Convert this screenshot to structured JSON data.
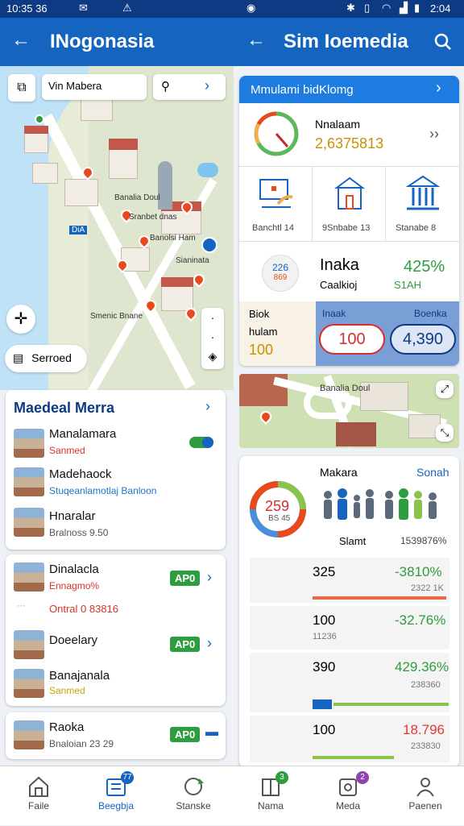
{
  "status": {
    "time_left": "10:35 36",
    "time_right": "2:04"
  },
  "left_header": {
    "title": "INogonasia"
  },
  "right_header": {
    "title": "Sim Ioemedia"
  },
  "map": {
    "search_text": "Vin Mabera",
    "labels": [
      "Banalia Doul",
      "Sranbet dnas",
      "Banolsi Ham",
      "Sianinata",
      "Smenic Bnane",
      "DiA"
    ],
    "saved_label": "Serroed"
  },
  "list_card1": {
    "title": "Maedeal Merra",
    "items": [
      {
        "title": "Manalamara",
        "sub": "Sanmed",
        "sub_color": "#d6342a"
      },
      {
        "title": "Madehaock",
        "sub": "Stuqeanlamotlaj Banloon",
        "sub_color": "#1976d2"
      },
      {
        "title": "Hnaralar",
        "sub": "Bralnoss 9.50",
        "sub_color": "#555555"
      }
    ]
  },
  "list_card2": {
    "items": [
      {
        "title": "Dinalacla",
        "sub": "Ennagmo%",
        "pill": "AP0"
      },
      {
        "title": "Ontral 0 83816",
        "sub": ""
      },
      {
        "title": "Doeelary",
        "sub": "",
        "pill": "AP0"
      },
      {
        "title": "Banajanala",
        "sub": "Sanmed"
      }
    ]
  },
  "list_card3": {
    "title": "Raoka",
    "sub": "Bnaloian 23 29",
    "pill": "AP0"
  },
  "info_card": {
    "header": "Mmulami bidKlomg",
    "gauge_label": "Nnalaam",
    "gauge_value": "2,6375813",
    "icons": [
      {
        "label": "Banchtl 14"
      },
      {
        "label": "9Snbabe 13"
      },
      {
        "label": "Stanabe 8"
      }
    ],
    "stat_badge_top": "226",
    "stat_badge_bottom": "869",
    "stat_label": "Inaka",
    "stat_sub": "Caalkioj",
    "stat_pct": "425%",
    "stat_pct_sub": "S1AH",
    "bottom_left_line1": "Biok",
    "bottom_left_line2": "hulam",
    "bottom_left_value": "100",
    "bottom_mid_label": "Inaak",
    "bottom_mid_value": "100",
    "bottom_right_label": "Boenka",
    "bottom_right_value": "4,390"
  },
  "stats_card": {
    "left_header": "Makara",
    "right_header": "Sonah",
    "donut_value": "259",
    "donut_sub": "BS 45",
    "people_label_left": "Slamt",
    "people_label_right": "1539876%",
    "rows": [
      {
        "value": "325",
        "pct": "-3810%",
        "sub": "2322 1K",
        "pct_color": "#2e9d3f",
        "bar_color": "#e8684a",
        "bar_fraction": 0.99
      },
      {
        "value": "100",
        "pct": "-32.76%",
        "sub": "11236",
        "pct_color": "#2e9d3f",
        "bar_color": "#e8684a",
        "bar_fraction": 0.0
      },
      {
        "value": "390",
        "pct": "429.36%",
        "sub": "238360",
        "pct_color": "#2e9d3f",
        "bar_color": "#8bc34a",
        "bar_fraction": 0.99
      },
      {
        "value": "100",
        "pct": "18.796",
        "sub": "233830",
        "pct_color": "#e53935",
        "bar_color": "#8bc34a",
        "bar_fraction": 0.6
      }
    ]
  },
  "bottom_nav": [
    {
      "label": "Faile"
    },
    {
      "label": "Beegbja",
      "badge": "77"
    },
    {
      "label": "Stanske"
    },
    {
      "label": "Nama",
      "badge": "3"
    },
    {
      "label": "Meda",
      "badge": "2"
    },
    {
      "label": "Paenen"
    }
  ]
}
